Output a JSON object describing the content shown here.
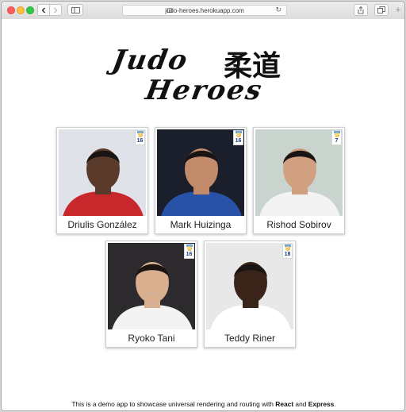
{
  "browser": {
    "url": "judo-heroes.herokuapp.com",
    "back_icon": "‹",
    "forward_icon": "›",
    "reload_icon": "↻"
  },
  "logo": {
    "line1": "Judo",
    "line2": "Heroes",
    "kanji": "柔道"
  },
  "athletes": [
    {
      "name": "Driulis González",
      "medals": "16",
      "photo_bg": "#dfe3e9",
      "skin": "#5a3a2a",
      "top": "#c8282c"
    },
    {
      "name": "Mark Huizinga",
      "medals": "16",
      "photo_bg": "#1b1f2b",
      "skin": "#c28b6b",
      "top": "#2851a8"
    },
    {
      "name": "Rishod Sobirov",
      "medals": "7",
      "photo_bg": "#c9d4cf",
      "skin": "#d0a080",
      "top": "#f3f3f3"
    },
    {
      "name": "Ryoko Tani",
      "medals": "16",
      "photo_bg": "#2c2a2c",
      "skin": "#d8b090",
      "top": "#f3f3f3"
    },
    {
      "name": "Teddy Riner",
      "medals": "18",
      "photo_bg": "#e8e8e8",
      "skin": "#3a2419",
      "top": "#ffffff"
    }
  ],
  "footer": {
    "prefix": "This is a demo app to showcase universal rendering and routing with ",
    "react": "React",
    "and": " and ",
    "express": "Express",
    "suffix": "."
  }
}
